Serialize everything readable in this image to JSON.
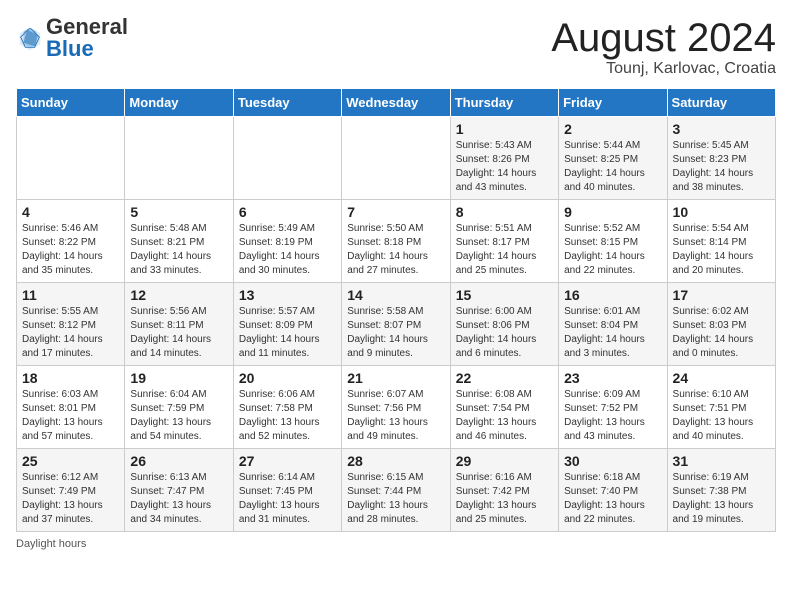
{
  "header": {
    "logo_general": "General",
    "logo_blue": "Blue",
    "title": "August 2024",
    "subtitle": "Tounj, Karlovac, Croatia"
  },
  "weekdays": [
    "Sunday",
    "Monday",
    "Tuesday",
    "Wednesday",
    "Thursday",
    "Friday",
    "Saturday"
  ],
  "weeks": [
    [
      {
        "day": "",
        "info": ""
      },
      {
        "day": "",
        "info": ""
      },
      {
        "day": "",
        "info": ""
      },
      {
        "day": "",
        "info": ""
      },
      {
        "day": "1",
        "info": "Sunrise: 5:43 AM\nSunset: 8:26 PM\nDaylight: 14 hours\nand 43 minutes."
      },
      {
        "day": "2",
        "info": "Sunrise: 5:44 AM\nSunset: 8:25 PM\nDaylight: 14 hours\nand 40 minutes."
      },
      {
        "day": "3",
        "info": "Sunrise: 5:45 AM\nSunset: 8:23 PM\nDaylight: 14 hours\nand 38 minutes."
      }
    ],
    [
      {
        "day": "4",
        "info": "Sunrise: 5:46 AM\nSunset: 8:22 PM\nDaylight: 14 hours\nand 35 minutes."
      },
      {
        "day": "5",
        "info": "Sunrise: 5:48 AM\nSunset: 8:21 PM\nDaylight: 14 hours\nand 33 minutes."
      },
      {
        "day": "6",
        "info": "Sunrise: 5:49 AM\nSunset: 8:19 PM\nDaylight: 14 hours\nand 30 minutes."
      },
      {
        "day": "7",
        "info": "Sunrise: 5:50 AM\nSunset: 8:18 PM\nDaylight: 14 hours\nand 27 minutes."
      },
      {
        "day": "8",
        "info": "Sunrise: 5:51 AM\nSunset: 8:17 PM\nDaylight: 14 hours\nand 25 minutes."
      },
      {
        "day": "9",
        "info": "Sunrise: 5:52 AM\nSunset: 8:15 PM\nDaylight: 14 hours\nand 22 minutes."
      },
      {
        "day": "10",
        "info": "Sunrise: 5:54 AM\nSunset: 8:14 PM\nDaylight: 14 hours\nand 20 minutes."
      }
    ],
    [
      {
        "day": "11",
        "info": "Sunrise: 5:55 AM\nSunset: 8:12 PM\nDaylight: 14 hours\nand 17 minutes."
      },
      {
        "day": "12",
        "info": "Sunrise: 5:56 AM\nSunset: 8:11 PM\nDaylight: 14 hours\nand 14 minutes."
      },
      {
        "day": "13",
        "info": "Sunrise: 5:57 AM\nSunset: 8:09 PM\nDaylight: 14 hours\nand 11 minutes."
      },
      {
        "day": "14",
        "info": "Sunrise: 5:58 AM\nSunset: 8:07 PM\nDaylight: 14 hours\nand 9 minutes."
      },
      {
        "day": "15",
        "info": "Sunrise: 6:00 AM\nSunset: 8:06 PM\nDaylight: 14 hours\nand 6 minutes."
      },
      {
        "day": "16",
        "info": "Sunrise: 6:01 AM\nSunset: 8:04 PM\nDaylight: 14 hours\nand 3 minutes."
      },
      {
        "day": "17",
        "info": "Sunrise: 6:02 AM\nSunset: 8:03 PM\nDaylight: 14 hours\nand 0 minutes."
      }
    ],
    [
      {
        "day": "18",
        "info": "Sunrise: 6:03 AM\nSunset: 8:01 PM\nDaylight: 13 hours\nand 57 minutes."
      },
      {
        "day": "19",
        "info": "Sunrise: 6:04 AM\nSunset: 7:59 PM\nDaylight: 13 hours\nand 54 minutes."
      },
      {
        "day": "20",
        "info": "Sunrise: 6:06 AM\nSunset: 7:58 PM\nDaylight: 13 hours\nand 52 minutes."
      },
      {
        "day": "21",
        "info": "Sunrise: 6:07 AM\nSunset: 7:56 PM\nDaylight: 13 hours\nand 49 minutes."
      },
      {
        "day": "22",
        "info": "Sunrise: 6:08 AM\nSunset: 7:54 PM\nDaylight: 13 hours\nand 46 minutes."
      },
      {
        "day": "23",
        "info": "Sunrise: 6:09 AM\nSunset: 7:52 PM\nDaylight: 13 hours\nand 43 minutes."
      },
      {
        "day": "24",
        "info": "Sunrise: 6:10 AM\nSunset: 7:51 PM\nDaylight: 13 hours\nand 40 minutes."
      }
    ],
    [
      {
        "day": "25",
        "info": "Sunrise: 6:12 AM\nSunset: 7:49 PM\nDaylight: 13 hours\nand 37 minutes."
      },
      {
        "day": "26",
        "info": "Sunrise: 6:13 AM\nSunset: 7:47 PM\nDaylight: 13 hours\nand 34 minutes."
      },
      {
        "day": "27",
        "info": "Sunrise: 6:14 AM\nSunset: 7:45 PM\nDaylight: 13 hours\nand 31 minutes."
      },
      {
        "day": "28",
        "info": "Sunrise: 6:15 AM\nSunset: 7:44 PM\nDaylight: 13 hours\nand 28 minutes."
      },
      {
        "day": "29",
        "info": "Sunrise: 6:16 AM\nSunset: 7:42 PM\nDaylight: 13 hours\nand 25 minutes."
      },
      {
        "day": "30",
        "info": "Sunrise: 6:18 AM\nSunset: 7:40 PM\nDaylight: 13 hours\nand 22 minutes."
      },
      {
        "day": "31",
        "info": "Sunrise: 6:19 AM\nSunset: 7:38 PM\nDaylight: 13 hours\nand 19 minutes."
      }
    ]
  ],
  "footer": {
    "note": "Daylight hours"
  }
}
